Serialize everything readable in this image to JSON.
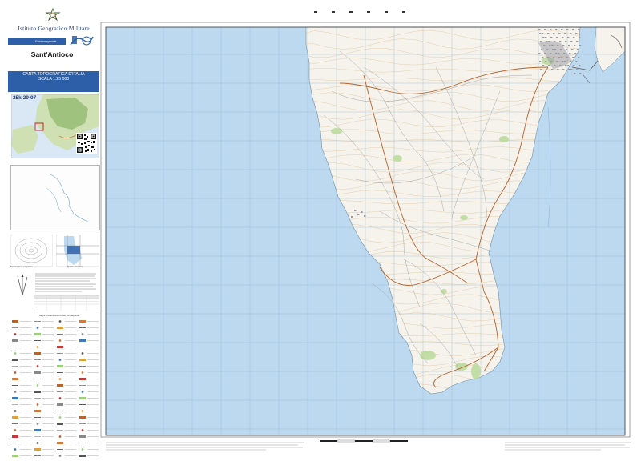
{
  "header": {
    "org_name": "Istituto Geografico Militare",
    "edition": "Edizione speciale"
  },
  "sheet": {
    "name": "Sant'Antioco",
    "code": "25k-29-07"
  },
  "title_box": {
    "line1": "CARTA TOPOGRAFICA D'ITALIA",
    "line2": "SCALA 1:25 000"
  },
  "captions": {
    "declination": "Declinazione magnetica",
    "assembly": "Quadro d'unione"
  },
  "legend": {
    "title": "Segni convenzionali di uso più frequente"
  },
  "map": {
    "colors": {
      "sea": "#bcd9ef",
      "land": "#f5f3ec",
      "urban": "#9a9aa2",
      "road_main": "#b8622c",
      "road_minor": "#a8a8a8",
      "vegetation": "#b9d99a",
      "contour": "#d9b98f",
      "grid": "#8fb2d0",
      "title_blue": "#2d5fa8"
    }
  }
}
